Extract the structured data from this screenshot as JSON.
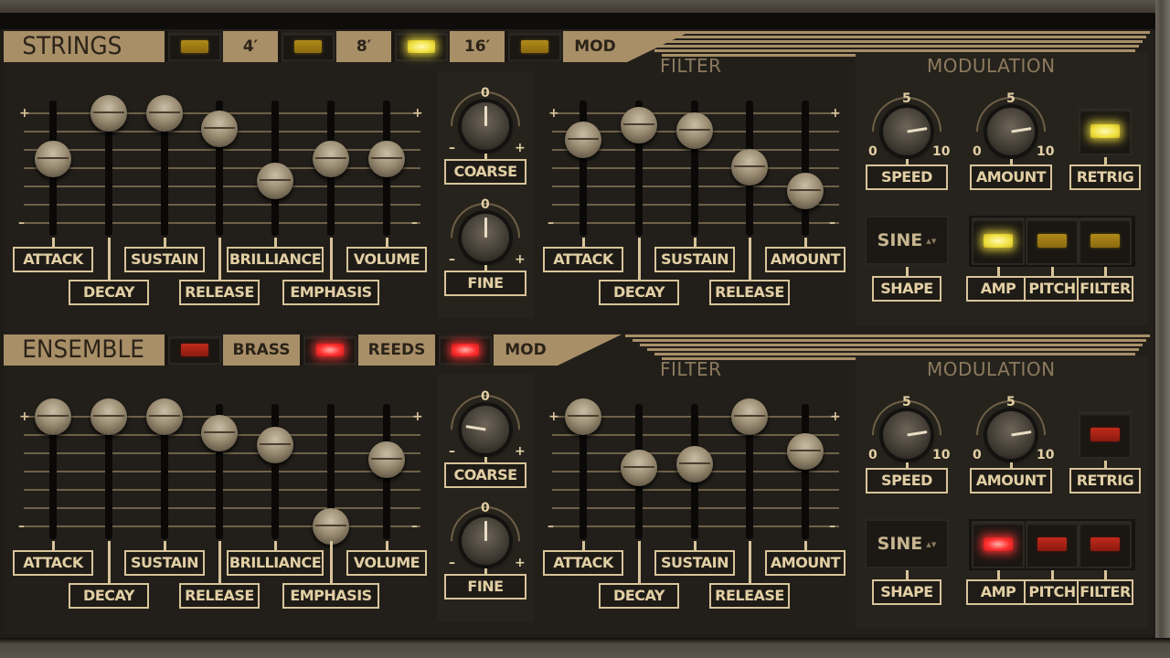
{
  "colors": {
    "panel": "#221f1a",
    "plate": "#a88f68",
    "label": "#d8c49a",
    "led_yellow": "#f0e040",
    "led_red": "#ff3030"
  },
  "sections": [
    {
      "id": "strings",
      "title": "STRINGS",
      "led_color": "yellow",
      "header_buttons": [
        {
          "label": "4′",
          "on": false
        },
        {
          "label": "8′",
          "on": false
        },
        {
          "label": "16′",
          "on": true
        },
        {
          "label": "MOD",
          "on": false
        }
      ],
      "envelope": {
        "scale_plus": "+",
        "scale_minus": "–",
        "sliders": [
          {
            "label": "ATTACK",
            "value": 0.58
          },
          {
            "label": "DECAY",
            "value": 1.0
          },
          {
            "label": "SUSTAIN",
            "value": 1.0
          },
          {
            "label": "RELEASE",
            "value": 0.86
          },
          {
            "label": "BRILLIANCE",
            "value": 0.38
          },
          {
            "label": "EMPHASIS",
            "value": 0.58
          },
          {
            "label": "VOLUME",
            "value": 0.58
          }
        ]
      },
      "tune": {
        "coarse": {
          "label": "COARSE",
          "zero": "0",
          "minus": "–",
          "plus": "+",
          "value": 0.0
        },
        "fine": {
          "label": "FINE",
          "zero": "0",
          "minus": "–",
          "plus": "+",
          "value": 0.0
        }
      },
      "filter": {
        "title": "FILTER",
        "scale_plus": "+",
        "scale_minus": "–",
        "sliders": [
          {
            "label": "ATTACK",
            "value": 0.76
          },
          {
            "label": "DECAY",
            "value": 0.89
          },
          {
            "label": "SUSTAIN",
            "value": 0.84
          },
          {
            "label": "RELEASE",
            "value": 0.51
          },
          {
            "label": "AMOUNT",
            "value": 0.29
          }
        ]
      },
      "modulation": {
        "title": "MODULATION",
        "speed": {
          "label": "SPEED",
          "min": "0",
          "mid": "5",
          "max": "10",
          "value": 8
        },
        "amount": {
          "label": "AMOUNT",
          "min": "0",
          "mid": "5",
          "max": "10",
          "value": 8
        },
        "retrig": {
          "label": "RETRIG",
          "on": true
        },
        "shape": {
          "label": "SHAPE",
          "value": "SINE",
          "arrows": "▴▾"
        },
        "targets": [
          {
            "label": "AMP",
            "on": true
          },
          {
            "label": "PITCH",
            "on": false
          },
          {
            "label": "FILTER",
            "on": false
          }
        ]
      }
    },
    {
      "id": "ensemble",
      "title": "ENSEMBLE",
      "led_color": "red",
      "header_buttons": [
        {
          "label": "BRASS",
          "on": false
        },
        {
          "label": "REEDS",
          "on": true
        },
        {
          "label": "MOD",
          "on": true
        }
      ],
      "envelope": {
        "scale_plus": "+",
        "scale_minus": "–",
        "sliders": [
          {
            "label": "ATTACK",
            "value": 1.0
          },
          {
            "label": "DECAY",
            "value": 1.0
          },
          {
            "label": "SUSTAIN",
            "value": 1.0
          },
          {
            "label": "RELEASE",
            "value": 0.85
          },
          {
            "label": "BRILLIANCE",
            "value": 0.74
          },
          {
            "label": "EMPHASIS",
            "value": 0.0
          },
          {
            "label": "VOLUME",
            "value": 0.61
          }
        ]
      },
      "tune": {
        "coarse": {
          "label": "COARSE",
          "zero": "0",
          "minus": "–",
          "plus": "+",
          "value": -0.6
        },
        "fine": {
          "label": "FINE",
          "zero": "0",
          "minus": "–",
          "plus": "+",
          "value": 0.0
        }
      },
      "filter": {
        "title": "FILTER",
        "scale_plus": "+",
        "scale_minus": "–",
        "sliders": [
          {
            "label": "ATTACK",
            "value": 1.0
          },
          {
            "label": "DECAY",
            "value": 0.53
          },
          {
            "label": "SUSTAIN",
            "value": 0.57
          },
          {
            "label": "RELEASE",
            "value": 1.0
          },
          {
            "label": "AMOUNT",
            "value": 0.68
          }
        ]
      },
      "modulation": {
        "title": "MODULATION",
        "speed": {
          "label": "SPEED",
          "min": "0",
          "mid": "5",
          "max": "10",
          "value": 8
        },
        "amount": {
          "label": "AMOUNT",
          "min": "0",
          "mid": "5",
          "max": "10",
          "value": 8
        },
        "retrig": {
          "label": "RETRIG",
          "on": false
        },
        "shape": {
          "label": "SHAPE",
          "value": "SINE",
          "arrows": "▴▾"
        },
        "targets": [
          {
            "label": "AMP",
            "on": true
          },
          {
            "label": "PITCH",
            "on": false
          },
          {
            "label": "FILTER",
            "on": false
          }
        ]
      }
    }
  ]
}
